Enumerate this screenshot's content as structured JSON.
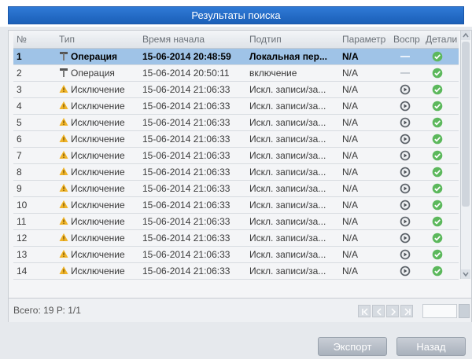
{
  "window": {
    "title": "Результаты поиска"
  },
  "table": {
    "headers": {
      "no": "№",
      "type": "Тип",
      "start_time": "Время начала",
      "subtype": "Подтип",
      "param": "Параметр",
      "play": "Воспр",
      "details": "Детали"
    },
    "rows": [
      {
        "no": "1",
        "type": "Операция",
        "type_icon": "wrench-icon",
        "time": "15-06-2014 20:48:59",
        "subtype": "Локальная пер...",
        "param": "N/A",
        "play": "none",
        "selected": true
      },
      {
        "no": "2",
        "type": "Операция",
        "type_icon": "wrench-icon",
        "time": "15-06-2014 20:50:11",
        "subtype": "включение",
        "param": "N/A",
        "play": "none",
        "selected": false
      },
      {
        "no": "3",
        "type": "Исключение",
        "type_icon": "warning-icon",
        "time": "15-06-2014 21:06:33",
        "subtype": "Искл. записи/за...",
        "param": "N/A",
        "play": "play",
        "selected": false
      },
      {
        "no": "4",
        "type": "Исключение",
        "type_icon": "warning-icon",
        "time": "15-06-2014 21:06:33",
        "subtype": "Искл. записи/за...",
        "param": "N/A",
        "play": "play",
        "selected": false
      },
      {
        "no": "5",
        "type": "Исключение",
        "type_icon": "warning-icon",
        "time": "15-06-2014 21:06:33",
        "subtype": "Искл. записи/за...",
        "param": "N/A",
        "play": "play",
        "selected": false
      },
      {
        "no": "6",
        "type": "Исключение",
        "type_icon": "warning-icon",
        "time": "15-06-2014 21:06:33",
        "subtype": "Искл. записи/за...",
        "param": "N/A",
        "play": "play",
        "selected": false
      },
      {
        "no": "7",
        "type": "Исключение",
        "type_icon": "warning-icon",
        "time": "15-06-2014 21:06:33",
        "subtype": "Искл. записи/за...",
        "param": "N/A",
        "play": "play",
        "selected": false
      },
      {
        "no": "8",
        "type": "Исключение",
        "type_icon": "warning-icon",
        "time": "15-06-2014 21:06:33",
        "subtype": "Искл. записи/за...",
        "param": "N/A",
        "play": "play",
        "selected": false
      },
      {
        "no": "9",
        "type": "Исключение",
        "type_icon": "warning-icon",
        "time": "15-06-2014 21:06:33",
        "subtype": "Искл. записи/за...",
        "param": "N/A",
        "play": "play",
        "selected": false
      },
      {
        "no": "10",
        "type": "Исключение",
        "type_icon": "warning-icon",
        "time": "15-06-2014 21:06:33",
        "subtype": "Искл. записи/за...",
        "param": "N/A",
        "play": "play",
        "selected": false
      },
      {
        "no": "11",
        "type": "Исключение",
        "type_icon": "warning-icon",
        "time": "15-06-2014 21:06:33",
        "subtype": "Искл. записи/за...",
        "param": "N/A",
        "play": "play",
        "selected": false
      },
      {
        "no": "12",
        "type": "Исключение",
        "type_icon": "warning-icon",
        "time": "15-06-2014 21:06:33",
        "subtype": "Искл. записи/за...",
        "param": "N/A",
        "play": "play",
        "selected": false
      },
      {
        "no": "13",
        "type": "Исключение",
        "type_icon": "warning-icon",
        "time": "15-06-2014 21:06:33",
        "subtype": "Искл. записи/за...",
        "param": "N/A",
        "play": "play",
        "selected": false
      },
      {
        "no": "14",
        "type": "Исключение",
        "type_icon": "warning-icon",
        "time": "15-06-2014 21:06:33",
        "subtype": "Искл. записи/за...",
        "param": "N/A",
        "play": "play",
        "selected": false
      }
    ]
  },
  "footer": {
    "total": "Всего: 19  Р: 1/1"
  },
  "buttons": {
    "export": "Экспорт",
    "back": "Назад"
  },
  "colors": {
    "accent": "#1b5fb8",
    "selected_row": "#9fc3e7",
    "ok": "#5cb85c",
    "warning": "#f0b429"
  }
}
